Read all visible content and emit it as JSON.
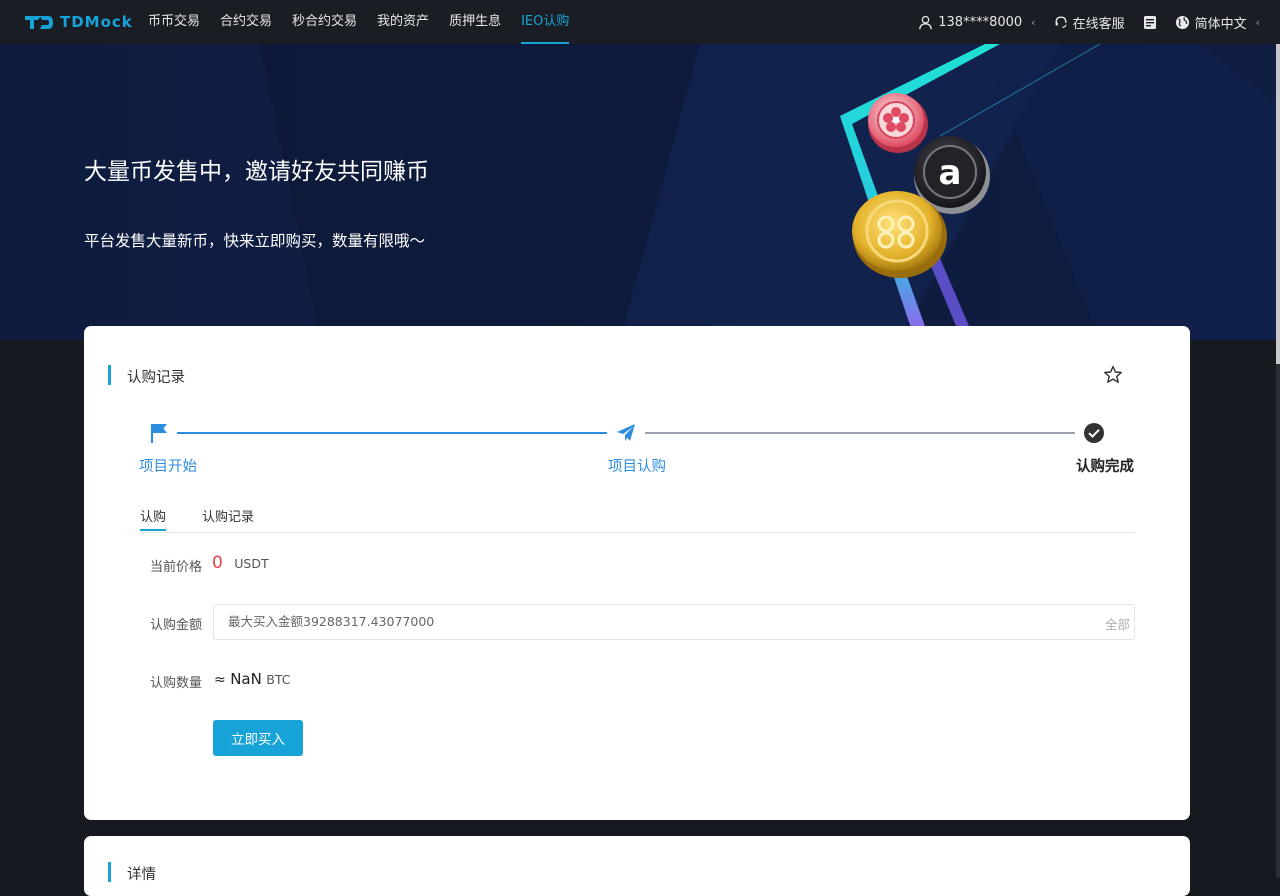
{
  "header": {
    "brand": "TDMock",
    "nav": [
      {
        "label": "币币交易",
        "active": false
      },
      {
        "label": "合约交易",
        "active": false
      },
      {
        "label": "秒合约交易",
        "active": false
      },
      {
        "label": "我的资产",
        "active": false
      },
      {
        "label": "质押生息",
        "active": false
      },
      {
        "label": "IEO认购",
        "active": true
      }
    ],
    "user": "138****8000",
    "support": "在线客服",
    "language": "简体中文"
  },
  "banner": {
    "title": "大量币发售中，邀请好友共同赚币",
    "subtitle": "平台发售大量新币，快来立即购买，数量有限哦～"
  },
  "card": {
    "title": "认购记录",
    "steps": [
      "项目开始",
      "项目认购",
      "认购完成"
    ],
    "tabs": [
      "认购",
      "认购记录"
    ],
    "price_label": "当前价格",
    "price_value": "0",
    "price_unit": "USDT",
    "amount_label": "认购金额",
    "amount_placeholder": "最大买入金额39288317.43077000",
    "all_label": "全部",
    "quantity_label": "认购数量",
    "quantity_prefix": "≈",
    "quantity_value": "NaN",
    "quantity_unit": "BTC",
    "buy_label": "立即买入"
  },
  "details": {
    "title": "详情"
  },
  "colors": {
    "accent": "#17a2d8",
    "price": "#e8404c",
    "banner_bg": "#0e1a3a",
    "page_bg": "#16191f"
  },
  "icons": [
    "user-icon",
    "headset-icon",
    "download-icon",
    "globe-icon",
    "star-icon",
    "flag-icon",
    "paper-plane-icon",
    "check-circle-icon"
  ]
}
